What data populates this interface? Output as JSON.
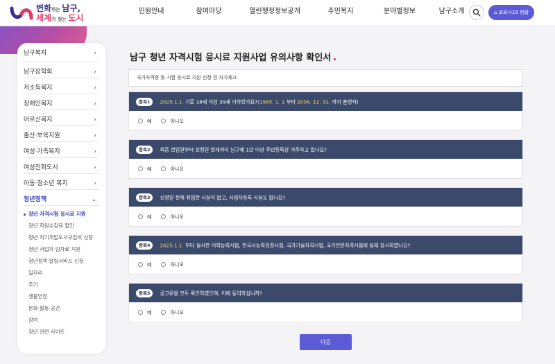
{
  "header": {
    "logo": {
      "line1_a": "변화",
      "line1_b": "하는 ",
      "line1_c": "남구,",
      "line2_a": "세계",
      "line2_b": "가 찾는 ",
      "line2_c": "도시"
    },
    "nav": [
      "민원안내",
      "참여마당",
      "열린행정정보공개",
      "주민복지",
      "분야별정보",
      "남구소개"
    ],
    "corona_label": "코로나19 현황"
  },
  "sidebar": {
    "items": [
      {
        "label": "남구복지",
        "chevron": "›"
      },
      {
        "label": "남구장학회",
        "chevron": "›"
      },
      {
        "label": "저소득복지",
        "chevron": "›"
      },
      {
        "label": "장애인복지",
        "chevron": "›"
      },
      {
        "label": "어르신복지",
        "chevron": "›"
      },
      {
        "label": "출산·보육지원",
        "chevron": "›"
      },
      {
        "label": "여성·가족복지",
        "chevron": "›"
      },
      {
        "label": "여성친화도시",
        "chevron": "›"
      },
      {
        "label": "아동·청소년 복지",
        "chevron": "›"
      },
      {
        "label": "청년정책",
        "chevron": "⌄"
      }
    ],
    "subitems": [
      "청년 자격시험 응시료 지원",
      "청년 학원수강료 할인",
      "청년 자기개발도서구입비 신청",
      "청년 사업자 임차료 지원",
      "청년정책 알림서비스 신청",
      "일자리",
      "주거",
      "생활안정",
      "문화·활동·공간",
      "참여",
      "청년 관련 사이트"
    ]
  },
  "main": {
    "title": "남구 청년 자격시험 응시료 지원사업 유의사항 확인서",
    "notice": "국가자격증 등 시험 응시료 지원 신청 전 자가체크",
    "questions": [
      {
        "badge": "항목1",
        "hl1": "2025.1.1.",
        "text1": " 기준 18세 이상 39세 이하인가요?(",
        "hl2": "1985. 1. 1",
        "text2": "   부터 ",
        "hl3": "2006. 12. 31.",
        "text3": "   까지 출생자)"
      },
      {
        "badge": "항목2",
        "hl1": "",
        "text1": "최종 전입일부터 신청일 현재까지 남구에 1년 이상 주민등록상 거주하고 있나요?",
        "hl2": "",
        "text2": "",
        "hl3": "",
        "text3": ""
      },
      {
        "badge": "항목3",
        "hl1": "",
        "text1": "신청일 현재 취업한 사실이 없고, 사업자등록 사실도 없나요?",
        "hl2": "",
        "text2": "",
        "hl3": "",
        "text3": ""
      },
      {
        "badge": "항목4",
        "hl1": "2025.1.1.",
        "text1": "   부터 실시한 어학능력시험, 한국사능력검정시험, 국가기술자격시험, 국가전문자격시험에 실제 응시하였나요?",
        "hl2": "",
        "text2": "",
        "hl3": "",
        "text3": ""
      },
      {
        "badge": "항목5",
        "hl1": "",
        "text1": "공고문을 모두 확인하였으며, 이에 동의하십니까?",
        "hl2": "",
        "text2": "",
        "hl3": "",
        "text3": ""
      }
    ],
    "option_yes": "예",
    "option_no": "아니오",
    "next_label": "다음"
  }
}
